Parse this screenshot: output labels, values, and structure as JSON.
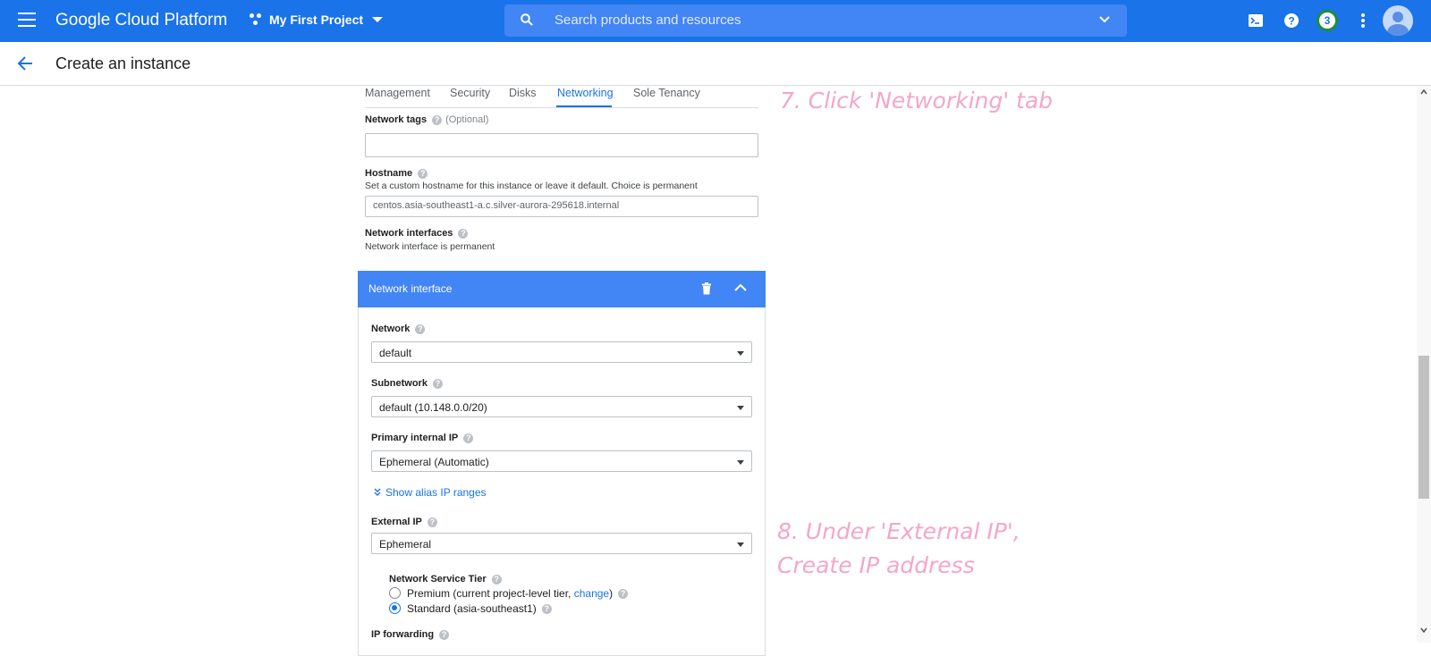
{
  "topbar": {
    "brand": "Google Cloud Platform",
    "project": "My First Project",
    "search_placeholder": "Search products and resources",
    "notification_count": "3",
    "accent_color": "#1a73e8"
  },
  "header": {
    "title": "Create an instance"
  },
  "tabs": [
    "Management",
    "Security",
    "Disks",
    "Networking",
    "Sole Tenancy"
  ],
  "active_tab": "Networking",
  "network_tags": {
    "label": "Network tags",
    "optional": "(Optional)",
    "value": ""
  },
  "hostname": {
    "label": "Hostname",
    "description": "Set a custom hostname for this instance or leave it default. Choice is permanent",
    "value": "centos.asia-southeast1-a.c.silver-aurora-295618.internal"
  },
  "network_interfaces": {
    "label": "Network interfaces",
    "description": "Network interface is permanent"
  },
  "network_interface": {
    "title": "Network interface",
    "network": {
      "label": "Network",
      "value": "default"
    },
    "subnetwork": {
      "label": "Subnetwork",
      "value": "default (10.148.0.0/20)"
    },
    "primary_ip": {
      "label": "Primary internal IP",
      "value": "Ephemeral (Automatic)"
    },
    "alias_link": "Show alias IP ranges",
    "external_ip": {
      "label": "External IP",
      "value": "Ephemeral"
    },
    "service_tier": {
      "label": "Network Service Tier",
      "premium_label": "Premium (current project-level tier, ",
      "premium_link": "change",
      "premium_close": ")",
      "standard_label": "Standard (asia-southeast1)",
      "selected": "standard"
    },
    "ip_forwarding": {
      "label": "IP forwarding"
    }
  },
  "annotations": {
    "step7": "7. Click 'Networking' tab",
    "step8_line1": "8. Under 'External IP',",
    "step8_line2": "Create IP address"
  }
}
